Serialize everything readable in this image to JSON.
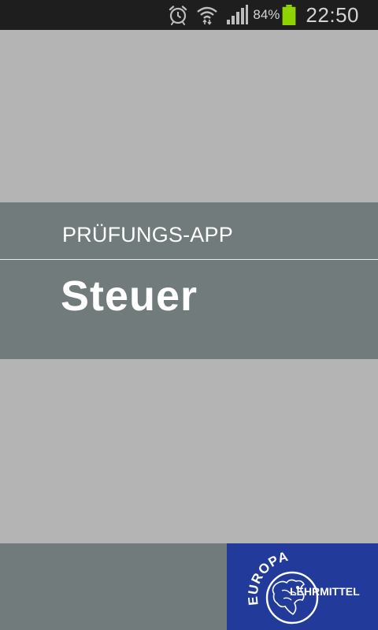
{
  "status_bar": {
    "battery_percent": "84%",
    "time": "22:50",
    "icons": [
      "alarm-icon",
      "wifi-icon",
      "signal-icon",
      "battery-icon"
    ],
    "battery_color": "#8fd400"
  },
  "splash": {
    "label": "PRÜFUNGS-APP",
    "title": "Steuer"
  },
  "publisher_logo": {
    "text_top": "EUROPA",
    "text_bottom": "LEHRMITTEL",
    "background": "#223a9a"
  },
  "colors": {
    "background": "#b4b4b4",
    "band": "#717b7b",
    "status_bar": "#1e1e1e"
  }
}
